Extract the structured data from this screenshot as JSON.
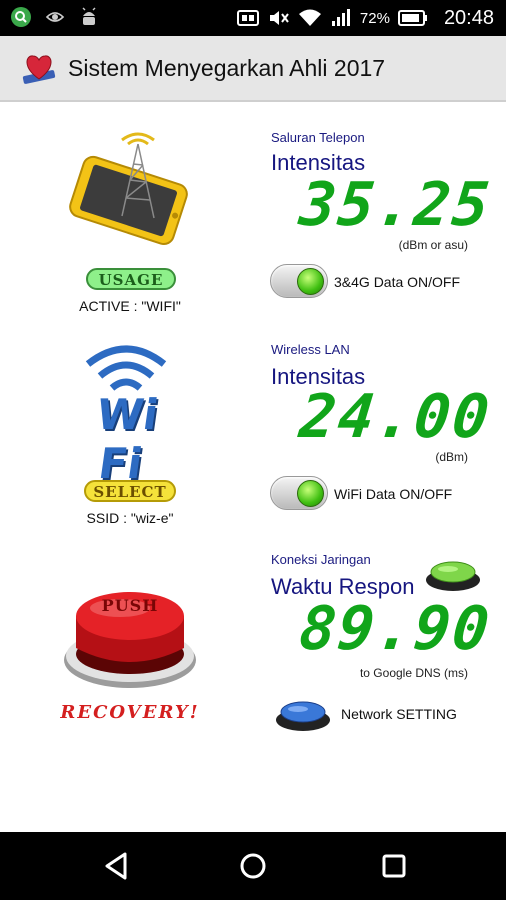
{
  "status_bar": {
    "notification_icons": [
      "search-icon",
      "eye-icon",
      "android-icon"
    ],
    "signal_icons": [
      "cast-icon",
      "mute-icon",
      "wifi-icon",
      "cell-signal-icon"
    ],
    "battery_percent": "72%",
    "time": "20:48"
  },
  "app": {
    "title": "Sistem Menyegarkan Ahli 2017"
  },
  "cellular": {
    "category": "Saluran Telepon",
    "metric": "Intensitas",
    "value": "35.25",
    "unit": "(dBm or asu)",
    "toggle_label": "3&4G Data ON/OFF",
    "toggle_on": true
  },
  "wireless": {
    "category": "Wireless LAN",
    "metric": "Intensitas",
    "value": "24.00",
    "unit": "(dBm)",
    "toggle_label": "WiFi Data ON/OFF",
    "toggle_on": true
  },
  "network": {
    "category": "Koneksi Jaringan",
    "metric": "Waktu Respon",
    "value": "89.90",
    "unit": "to Google DNS (ms)",
    "setting_label": "Network SETTING"
  },
  "left_panel": {
    "usage_badge": "USAGE",
    "active_text": "ACTIVE : \"WIFI\"",
    "wifi_logo_text": "Wi Fi",
    "select_badge": "SELECT",
    "ssid_text": "SSID : \"wiz-e\"",
    "push_label": "PUSH",
    "recovery_label": "RECOVERY!"
  },
  "colors": {
    "digits": "#11a51a",
    "title_blue": "#161680",
    "usage_badge": "#8ef08a",
    "select_badge": "#f5e23a",
    "push_red": "#d7171b",
    "recovery_red": "#d41f1f"
  }
}
